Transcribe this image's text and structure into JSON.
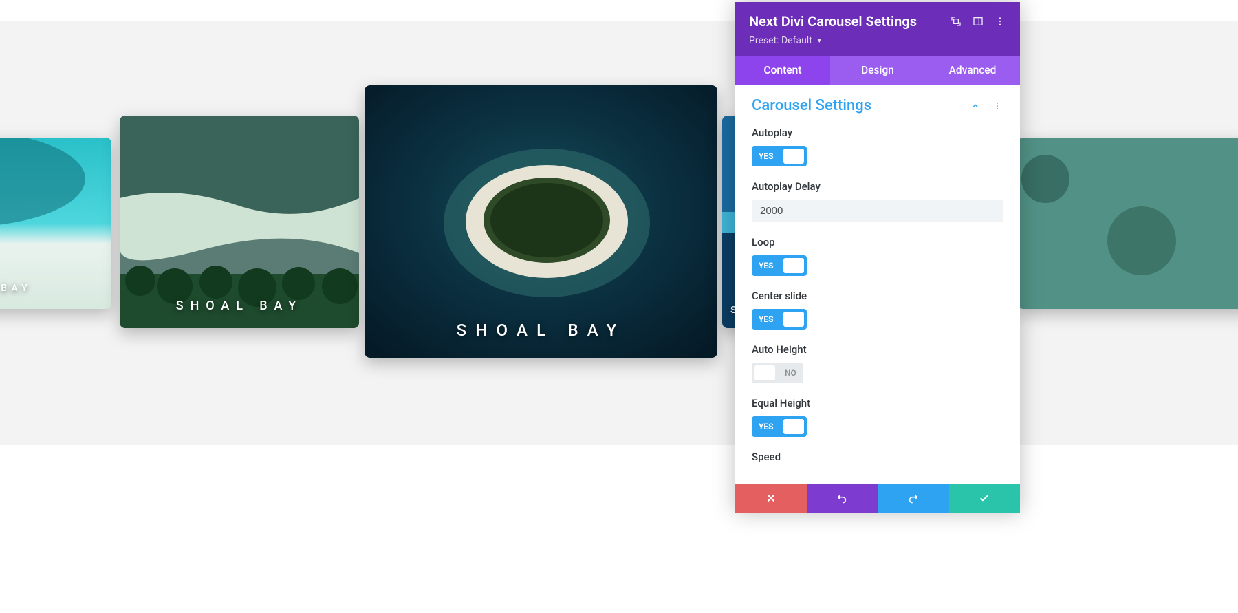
{
  "carousel": {
    "caption_text": "SHOAL BAY",
    "slides": {
      "far_left": {
        "caption": "HOAL BAY"
      },
      "left": {
        "caption": "SHOAL BAY"
      },
      "center": {
        "caption": "SHOAL BAY"
      },
      "right": {
        "caption": "SH"
      },
      "far_right": {
        "caption": ""
      }
    }
  },
  "panel": {
    "title": "Next Divi Carousel Settings",
    "preset_label": "Preset:",
    "preset_value": "Default",
    "tabs": {
      "content": "Content",
      "design": "Design",
      "advanced": "Advanced"
    },
    "section_title": "Carousel Settings",
    "toggle_yes": "YES",
    "toggle_no": "NO",
    "fields": {
      "autoplay": {
        "label": "Autoplay",
        "on": true
      },
      "autoplay_delay": {
        "label": "Autoplay Delay",
        "value": "2000"
      },
      "loop": {
        "label": "Loop",
        "on": true
      },
      "center_slide": {
        "label": "Center slide",
        "on": true
      },
      "auto_height": {
        "label": "Auto Height",
        "on": false
      },
      "equal_height": {
        "label": "Equal Height",
        "on": true
      },
      "speed": {
        "label": "Speed"
      }
    },
    "colors": {
      "header_bg": "#6c2eb9",
      "tab_bg": "#8e44ec",
      "tab_inactive_bg": "#9b5cf0",
      "accent_blue": "#2ea3f2",
      "footer_cancel": "#e46060",
      "footer_undo": "#7e3bd0",
      "footer_redo": "#2ea3f2",
      "footer_save": "#29c4a9"
    }
  }
}
